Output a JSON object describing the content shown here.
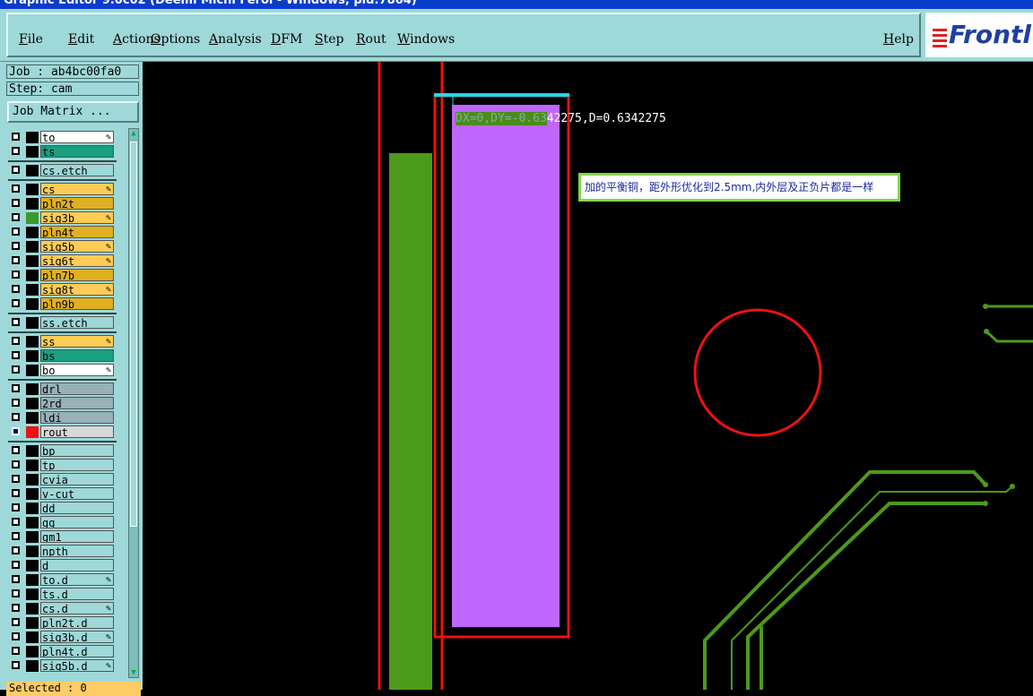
{
  "window": {
    "title": "Graphic Editor 9.0c02 (Deemi Michi Feroi - Windows, pid:7864)"
  },
  "menu": {
    "items": [
      "File",
      "Edit",
      "Actions",
      "Options",
      "Analysis",
      "DFM",
      "Step",
      "Rout",
      "Windows"
    ],
    "help": "Help"
  },
  "logo": {
    "text": "Frontl"
  },
  "panel": {
    "job": "Job : ab4bc00fa0",
    "step": "Step: cam",
    "job_matrix": "Job Matrix ...",
    "selected": "Selected : 0"
  },
  "layers": [
    {
      "name": "to",
      "bg": "#ffffff",
      "pen": true,
      "group": 0
    },
    {
      "name": "ts",
      "bg": "#1aa080",
      "group": 0
    },
    {
      "name": "cs.etch",
      "bg": "#9fd8d8",
      "group": 1
    },
    {
      "name": "cs",
      "bg": "#ffcc55",
      "pen": true,
      "group": 2
    },
    {
      "name": "pln2t",
      "bg": "#e0b020",
      "group": 2
    },
    {
      "name": "sig3b",
      "bg": "#ffcc55",
      "pen": true,
      "swatch": "#3a9a2a",
      "group": 2
    },
    {
      "name": "pln4t",
      "bg": "#e0b020",
      "group": 2
    },
    {
      "name": "sig5b",
      "bg": "#ffcc55",
      "pen": true,
      "group": 2
    },
    {
      "name": "sig6t",
      "bg": "#ffcc55",
      "pen": true,
      "group": 2
    },
    {
      "name": "pln7b",
      "bg": "#e0b020",
      "group": 2
    },
    {
      "name": "sig8t",
      "bg": "#ffcc55",
      "pen": true,
      "group": 2
    },
    {
      "name": "pln9b",
      "bg": "#e0b020",
      "group": 2
    },
    {
      "name": "ss.etch",
      "bg": "#9fd8d8",
      "group": 3
    },
    {
      "name": "ss",
      "bg": "#ffcc55",
      "pen": true,
      "group": 4
    },
    {
      "name": "bs",
      "bg": "#1aa080",
      "group": 4
    },
    {
      "name": "bo",
      "bg": "#ffffff",
      "pen": true,
      "group": 4
    },
    {
      "name": "drl",
      "bg": "#98b0b8",
      "group": 5
    },
    {
      "name": "2rd",
      "bg": "#98b0b8",
      "group": 5
    },
    {
      "name": "ldi",
      "bg": "#98b0b8",
      "group": 5
    },
    {
      "name": "rout",
      "bg": "#d8d8d8",
      "active": true,
      "swatch": "#ee1111",
      "group": 5
    },
    {
      "name": "bp",
      "bg": "#9fd8d8",
      "group": 6
    },
    {
      "name": "tp",
      "bg": "#9fd8d8",
      "group": 6
    },
    {
      "name": "cvia",
      "bg": "#9fd8d8",
      "group": 6
    },
    {
      "name": "v-cut",
      "bg": "#9fd8d8",
      "group": 6
    },
    {
      "name": "dd",
      "bg": "#9fd8d8",
      "group": 6
    },
    {
      "name": "gg",
      "bg": "#9fd8d8",
      "group": 6
    },
    {
      "name": "gm1",
      "bg": "#9fd8d8",
      "group": 6
    },
    {
      "name": "npth",
      "bg": "#9fd8d8",
      "group": 6
    },
    {
      "name": "d",
      "bg": "#9fd8d8",
      "group": 6
    },
    {
      "name": "to.d",
      "bg": "#9fd8d8",
      "pen": true,
      "group": 6
    },
    {
      "name": "ts.d",
      "bg": "#9fd8d8",
      "group": 6
    },
    {
      "name": "cs.d",
      "bg": "#9fd8d8",
      "pen": true,
      "group": 6
    },
    {
      "name": "pln2t.d",
      "bg": "#9fd8d8",
      "group": 6
    },
    {
      "name": "sig3b.d",
      "bg": "#9fd8d8",
      "pen": true,
      "group": 6
    },
    {
      "name": "pln4t.d",
      "bg": "#9fd8d8",
      "group": 6
    },
    {
      "name": "sig5b.d",
      "bg": "#9fd8d8",
      "pen": true,
      "group": 6
    }
  ],
  "canvas": {
    "measure_highlight": "DX=0,DY=-0.63",
    "measure_rest": "42275,D=0.6342275",
    "note": "加的平衡铜，距外形优化到2.5mm,内外层及正负片都是一样"
  },
  "colors": {
    "background": "#000000",
    "rout": "#ee1111",
    "copper": "#4c9a1a",
    "fill": "#bf66ff",
    "snap": "#20d8e8"
  }
}
